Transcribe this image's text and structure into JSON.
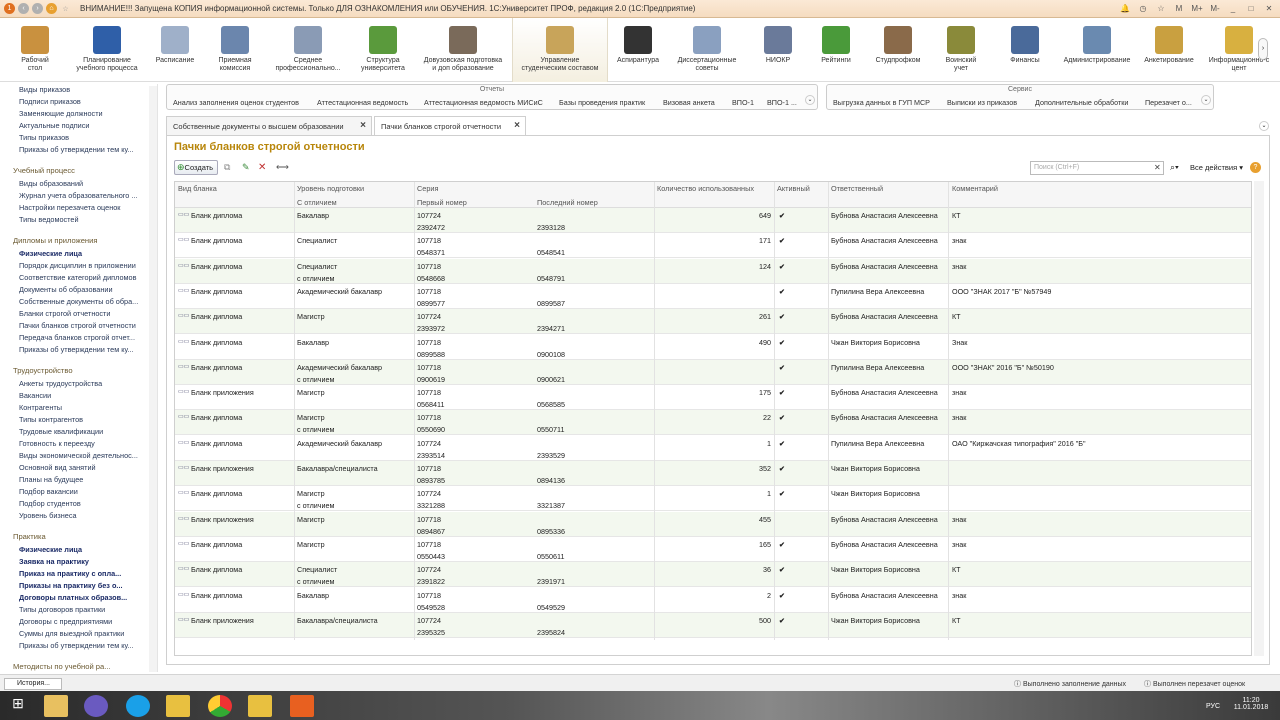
{
  "window": {
    "title": "ВНИМАНИЕ!!! Запущена КОПИЯ информационной системы. Только ДЛЯ ОЗНАКОМЛЕНИЯ или ОБУЧЕНИЯ. 1С:Университет ПРОФ, редакция 2.0  (1С:Предприятие)",
    "controls": [
      "M",
      "M+",
      "M-",
      "_",
      "□",
      "✕"
    ]
  },
  "ribbon": [
    {
      "l1": "Рабочий",
      "l2": "стол",
      "icon": "desk-icon",
      "color": "#c9913f"
    },
    {
      "l1": "Планирование",
      "l2": "учебного процесса",
      "icon": "plan-book-icon",
      "color": "#2f5fa8"
    },
    {
      "l1": "Расписание",
      "l2": "",
      "icon": "calendar-icon",
      "color": "#9fb0c9"
    },
    {
      "l1": "Приемная",
      "l2": "комиссия",
      "icon": "admission-doc-icon",
      "color": "#6b86ad"
    },
    {
      "l1": "Среднее",
      "l2": "профессионально...",
      "icon": "document-icon",
      "color": "#8a9bb5"
    },
    {
      "l1": "Структура",
      "l2": "университета",
      "icon": "structure-icon",
      "color": "#5a9a3c"
    },
    {
      "l1": "Довузовская подготовка",
      "l2": "и доп образование",
      "icon": "user-icon",
      "color": "#7a6a5a"
    },
    {
      "l1": "Управление",
      "l2": "студенческим составом",
      "icon": "students-card-icon",
      "color": "#c8a45a"
    },
    {
      "l1": "Аспирантура",
      "l2": "",
      "icon": "graduation-cap-icon",
      "color": "#333333"
    },
    {
      "l1": "Диссертационные",
      "l2": "советы",
      "icon": "dissertation-icon",
      "color": "#8aa0c0"
    },
    {
      "l1": "НИОКР",
      "l2": "",
      "icon": "microscope-icon",
      "color": "#6a7a9a"
    },
    {
      "l1": "Рейтинги",
      "l2": "",
      "icon": "rating-ball-icon",
      "color": "#4a9a3a"
    },
    {
      "l1": "Студпрофком",
      "l2": "",
      "icon": "people-icon",
      "color": "#8a6a4a"
    },
    {
      "l1": "Воинский",
      "l2": "учет",
      "icon": "shield-icon",
      "color": "#8a8a3a"
    },
    {
      "l1": "Финансы",
      "l2": "",
      "icon": "calculator-icon",
      "color": "#4a6a9a"
    },
    {
      "l1": "Администрирование",
      "l2": "",
      "icon": "gear-icon",
      "color": "#6a8ab0"
    },
    {
      "l1": "Анкетирование",
      "l2": "",
      "icon": "question-icon",
      "color": "#c9a040"
    },
    {
      "l1": "Информационно-с",
      "l2": "цент",
      "icon": "info-center-icon",
      "color": "#d8b040"
    }
  ],
  "leftnav": {
    "top_items": [
      "Виды приказов",
      "Подписи приказов",
      "Заменяющие должности",
      "Актуальные подписи",
      "Типы приказов",
      "Приказы об утверждении тем ку..."
    ],
    "g1": {
      "header": "Учебный процесс",
      "items": [
        "Виды образований",
        "Журнал учета образовательного ...",
        "Настройки перезачета оценок",
        "Типы ведомостей"
      ]
    },
    "g2": {
      "header": "Дипломы и приложения",
      "items": [
        {
          "t": "Физические лица",
          "b": true
        },
        {
          "t": "Порядок дисциплин в приложении"
        },
        {
          "t": "Соответствие категорий дипломов"
        },
        {
          "t": "Документы об образовании"
        },
        {
          "t": "Собственные документы об обра..."
        },
        {
          "t": "Бланки строгой отчетности"
        },
        {
          "t": "Пачки бланков строгой отчетности"
        },
        {
          "t": "Передача бланков строгой отчет..."
        },
        {
          "t": "Приказы об утверждении тем ку..."
        }
      ]
    },
    "g3": {
      "header": "Трудоустройство",
      "items": [
        "Анкеты трудоустройства",
        "Вакансии",
        "Контрагенты",
        "Типы контрагентов",
        "Трудовые квалификации",
        "Готовность к переезду",
        "Виды экономической деятельнос...",
        "Основной вид занятий",
        "Планы на будущее",
        "Подбор вакансии",
        "Подбор студентов",
        "Уровень бизнеса"
      ]
    },
    "g4": {
      "header": "Практика",
      "items": [
        {
          "t": "Физические лица",
          "b": true
        },
        {
          "t": "Заявка на практику",
          "b": true
        },
        {
          "t": "Приказ на практику с опла...",
          "b": true
        },
        {
          "t": "Приказы на практику без о...",
          "b": true
        },
        {
          "t": "Договоры платных образов...",
          "b": true
        },
        {
          "t": "Типы договоров практики"
        },
        {
          "t": "Договоры с предприятиями"
        },
        {
          "t": "Суммы для выездной практики"
        },
        {
          "t": "Приказы об утверждении тем ку..."
        }
      ]
    },
    "g5": {
      "header": "Методисты по учебной ра..."
    }
  },
  "panels": {
    "reports": {
      "header": "Отчеты",
      "items": [
        "Анализ заполнения оценок студентов",
        "Аттестационная ведомость",
        "Аттестационная ведомость МИСиС",
        "Базы проведения практик",
        "Визовая анкета",
        "ВПО-1",
        "ВПО-1 ..."
      ]
    },
    "service": {
      "header": "Сервис",
      "items": [
        "Выгрузка данных в ГУП МСР",
        "Выписки из приказов",
        "Дополнительные обработки",
        "Перезачет о..."
      ]
    }
  },
  "tabs": [
    {
      "label": "Собственные документы о высшем образовании"
    },
    {
      "label": "Пачки бланков строгой отчетности"
    }
  ],
  "page": {
    "title": "Пачки бланков строгой отчетности",
    "create_label": "Создать",
    "search_placeholder": "Поиск (Ctrl+F)",
    "all_actions": "Все действия"
  },
  "table": {
    "headers": {
      "type": "Вид бланка",
      "level": "Уровень подготовки",
      "with_honors": "С отличием",
      "series": "Серия",
      "first": "Первый номер",
      "last": "Последний номер",
      "used": "Количество использованных",
      "active": "Активный",
      "resp": "Ответственный",
      "comment": "Комментарий"
    },
    "rows": [
      {
        "type": "Бланк диплома",
        "level": "Бакалавр",
        "level2": "",
        "series": "107724",
        "first": "2392472",
        "last": "2393128",
        "used": "649",
        "active": true,
        "resp": "Бубнова Анастасия Алексеевна",
        "comment": "КТ"
      },
      {
        "type": "Бланк диплома",
        "level": "Специалист",
        "level2": "",
        "series": "107718",
        "first": "0548371",
        "last": "0548541",
        "used": "171",
        "active": true,
        "resp": "Бубнова Анастасия Алексеевна",
        "comment": "знак"
      },
      {
        "type": "Бланк диплома",
        "level": "Специалист",
        "level2": "с отличием",
        "series": "107718",
        "first": "0548668",
        "last": "0548791",
        "used": "124",
        "active": true,
        "resp": "Бубнова Анастасия Алексеевна",
        "comment": "знак"
      },
      {
        "type": "Бланк диплома",
        "level": "Академический бакалавр",
        "level2": "",
        "series": "107718",
        "first": "0899577",
        "last": "0899587",
        "used": "",
        "active": true,
        "resp": "Пупилина Вера Алексеевна",
        "comment": "ООО \"ЗНАК 2017 \"Б\" №57949"
      },
      {
        "type": "Бланк диплома",
        "level": "Магистр",
        "level2": "",
        "series": "107724",
        "first": "2393972",
        "last": "2394271",
        "used": "261",
        "active": true,
        "resp": "Бубнова Анастасия Алексеевна",
        "comment": "КТ"
      },
      {
        "type": "Бланк диплома",
        "level": "Бакалавр",
        "level2": "",
        "series": "107718",
        "first": "0899588",
        "last": "0900108",
        "used": "490",
        "active": true,
        "resp": "Чжан Виктория Борисовна",
        "comment": "Знак"
      },
      {
        "type": "Бланк диплома",
        "level": "Академический бакалавр",
        "level2": "с отличием",
        "series": "107718",
        "first": "0900619",
        "last": "0900621",
        "used": "",
        "active": true,
        "resp": "Пупилина Вера Алексеевна",
        "comment": "ООО \"ЗНАК\" 2016 \"Б\" №50190"
      },
      {
        "type": "Бланк приложения",
        "level": "Магистр",
        "level2": "",
        "series": "107718",
        "first": "0568411",
        "last": "0568585",
        "used": "175",
        "active": true,
        "resp": "Бубнова Анастасия Алексеевна",
        "comment": "знак"
      },
      {
        "type": "Бланк диплома",
        "level": "Магистр",
        "level2": "с отличием",
        "series": "107718",
        "first": "0550690",
        "last": "0550711",
        "used": "22",
        "active": true,
        "resp": "Бубнова Анастасия Алексеевна",
        "comment": "знак"
      },
      {
        "type": "Бланк диплома",
        "level": "Академический бакалавр",
        "level2": "",
        "series": "107724",
        "first": "2393514",
        "last": "2393529",
        "used": "1",
        "active": true,
        "resp": "Пупилина Вера Алексеевна",
        "comment": "ОАО \"Киржачская типография\" 2016 \"Б\""
      },
      {
        "type": "Бланк приложения",
        "level": "Бакалавра/специалиста",
        "level2": "",
        "series": "107718",
        "first": "0893785",
        "last": "0894136",
        "used": "352",
        "active": true,
        "resp": "Чжан Виктория Борисовна",
        "comment": ""
      },
      {
        "type": "Бланк диплома",
        "level": "Магистр",
        "level2": "с отличием",
        "series": "107724",
        "first": "3321288",
        "last": "3321387",
        "used": "1",
        "active": true,
        "resp": "Чжан Виктория Борисовна",
        "comment": ""
      },
      {
        "type": "Бланк приложения",
        "level": "Магистр",
        "level2": "",
        "series": "107718",
        "first": "0894867",
        "last": "0895336",
        "used": "455",
        "active": false,
        "resp": "Бубнова Анастасия Алексеевна",
        "comment": "знак"
      },
      {
        "type": "Бланк диплома",
        "level": "Магистр",
        "level2": "",
        "series": "107718",
        "first": "0550443",
        "last": "0550611",
        "used": "165",
        "active": true,
        "resp": "Бубнова Анастасия Алексеевна",
        "comment": "знак"
      },
      {
        "type": "Бланк диплома",
        "level": "Специалист",
        "level2": "с отличием",
        "series": "107724",
        "first": "2391822",
        "last": "2391971",
        "used": "36",
        "active": true,
        "resp": "Чжан Виктория Борисовна",
        "comment": "КТ"
      },
      {
        "type": "Бланк диплома",
        "level": "Бакалавр",
        "level2": "",
        "series": "107718",
        "first": "0549528",
        "last": "0549529",
        "used": "2",
        "active": true,
        "resp": "Бубнова Анастасия Алексеевна",
        "comment": "знак"
      },
      {
        "type": "Бланк приложения",
        "level": "Бакалавра/специалиста",
        "level2": "",
        "series": "107724",
        "first": "2395325",
        "last": "2395824",
        "used": "500",
        "active": true,
        "resp": "Чжан Виктория Борисовна",
        "comment": "КТ"
      }
    ]
  },
  "status": {
    "history": "История...",
    "msg1": "Выполнено заполнение данных",
    "msg2": "Выполнен перезачет оценок"
  },
  "taskbar": {
    "lang": "РУС",
    "time": "11:20",
    "date": "11.01.2018"
  },
  "colors": {
    "title_accent": "#b8860b",
    "row_alt": "#f3f8ef",
    "titlebar": "#f5dcc0"
  }
}
